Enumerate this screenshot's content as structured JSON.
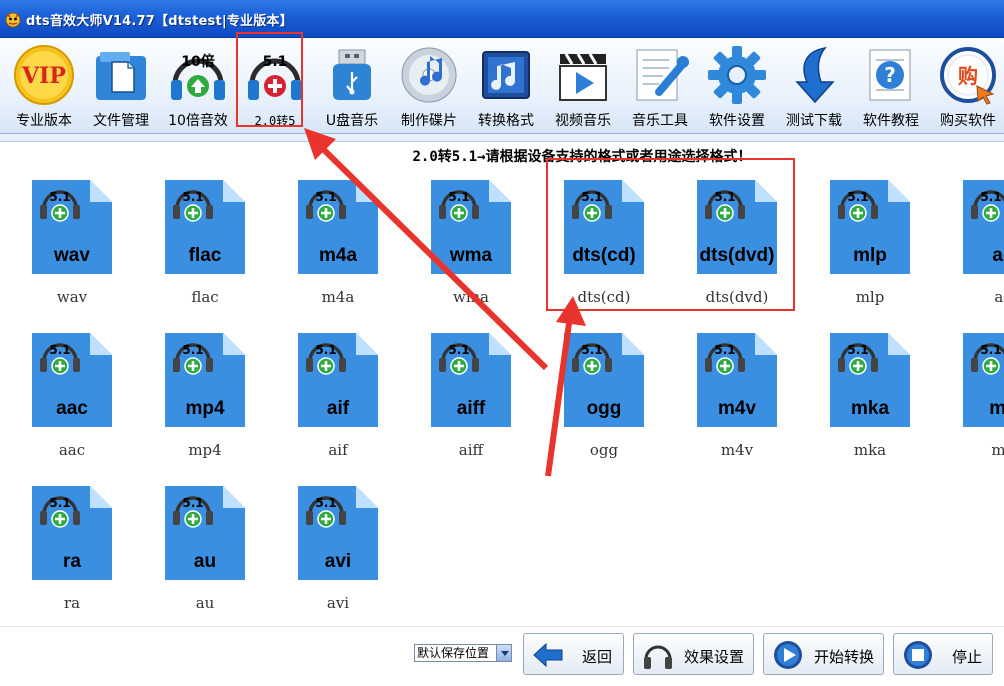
{
  "window": {
    "title": "dts音效大师V14.77【dtstest|专业版本】"
  },
  "toolbar": {
    "items": [
      {
        "label": "专业版本",
        "icon": "vip-icon"
      },
      {
        "label": "文件管理",
        "icon": "file-manager-icon"
      },
      {
        "label": "10倍音效",
        "icon": "10x-boost-icon",
        "badge": "10倍"
      },
      {
        "label": "2.0转5",
        "icon": "surround-51-icon",
        "badge": "5.1"
      },
      {
        "label": "U盘音乐",
        "icon": "usb-drive-icon"
      },
      {
        "label": "制作碟片",
        "icon": "disc-icon"
      },
      {
        "label": "转换格式",
        "icon": "music-convert-icon"
      },
      {
        "label": "视频音乐",
        "icon": "video-clapper-icon"
      },
      {
        "label": "音乐工具",
        "icon": "tools-icon"
      },
      {
        "label": "软件设置",
        "icon": "gear-icon"
      },
      {
        "label": "测试下载",
        "icon": "download-arrow-icon"
      },
      {
        "label": "软件教程",
        "icon": "help-icon"
      },
      {
        "label": "购买软件",
        "icon": "buy-icon",
        "badge": "购"
      }
    ]
  },
  "heading": "2.0转5.1→请根据设备支持的格式或者用途选择格式！",
  "formats": [
    {
      "name": "wav",
      "caption": "wav"
    },
    {
      "name": "flac",
      "caption": "flac"
    },
    {
      "name": "m4a",
      "caption": "m4a"
    },
    {
      "name": "wma",
      "caption": "wma"
    },
    {
      "name": "dts(cd)",
      "caption": "dts(cd)"
    },
    {
      "name": "dts(dvd)",
      "caption": "dts(dvd)"
    },
    {
      "name": "mlp",
      "caption": "mlp"
    },
    {
      "name": "ac",
      "caption": "ac"
    },
    {
      "name": "aac",
      "caption": "aac"
    },
    {
      "name": "mp4",
      "caption": "mp4"
    },
    {
      "name": "aif",
      "caption": "aif"
    },
    {
      "name": "aiff",
      "caption": "aiff"
    },
    {
      "name": "ogg",
      "caption": "ogg"
    },
    {
      "name": "m4v",
      "caption": "m4v"
    },
    {
      "name": "mka",
      "caption": "mka"
    },
    {
      "name": "mk",
      "caption": "mk"
    },
    {
      "name": "ra",
      "caption": "ra"
    },
    {
      "name": "au",
      "caption": "au"
    },
    {
      "name": "avi",
      "caption": "avi"
    }
  ],
  "file_badge": "5.1",
  "bottom": {
    "save_location": "默认保存位置",
    "buttons": [
      {
        "label": "返回",
        "icon": "back-arrow-icon"
      },
      {
        "label": "效果设置",
        "icon": "headphones-icon"
      },
      {
        "label": "开始转换",
        "icon": "play-icon"
      },
      {
        "label": "停止",
        "icon": "stop-icon"
      }
    ]
  },
  "colors": {
    "titlebar": "#1a5fd6",
    "file_blue": "#3b8fe0",
    "annotation": "#e8342c"
  }
}
